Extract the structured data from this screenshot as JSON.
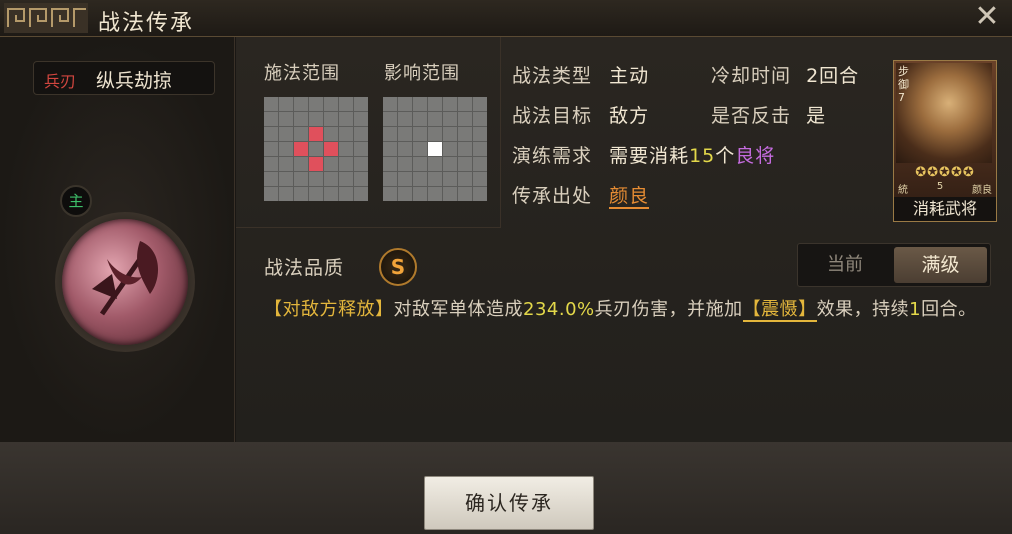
{
  "window": {
    "title": "战法传承"
  },
  "skill": {
    "type": "兵刃",
    "name": "纵兵劫掠",
    "main_badge": "主"
  },
  "ranges": {
    "cast_label": "施法范围",
    "effect_label": "影响范围"
  },
  "info": {
    "type_label": "战法类型",
    "type_value": "主动",
    "cooldown_label": "冷却时间",
    "cooldown_value": "2回合",
    "target_label": "战法目标",
    "target_value": "敌方",
    "counter_label": "是否反击",
    "counter_value": "是",
    "practice_label": "演练需求",
    "practice_prefix": "需要消耗",
    "practice_count": "15",
    "practice_unit": "个",
    "practice_item": "良将",
    "source_label": "传承出处",
    "source_value": "颜良"
  },
  "general_card": {
    "side_text": "步 御 7",
    "stars": "✪✪✪✪✪",
    "cost_label": "統",
    "cost": "5",
    "name": "颜良",
    "footer": "消耗武将"
  },
  "quality": {
    "label": "战法品质",
    "grade": "S"
  },
  "level_toggle": {
    "current": "当前",
    "max": "满级"
  },
  "description": {
    "trigger": "【对敌方释放】",
    "part1": "对敌军单体造成",
    "percent": "234.0%",
    "part2": "兵刃伤害，并施加",
    "status": "【震慑】",
    "part3": "效果，持续",
    "turns": "1",
    "part4": "回合。"
  },
  "confirm_button": "确认传承",
  "colors": {
    "accent_gold": "#e3b63c",
    "red_cell": "#e0505c",
    "purple": "#c46bde",
    "orange": "#e58c33"
  }
}
